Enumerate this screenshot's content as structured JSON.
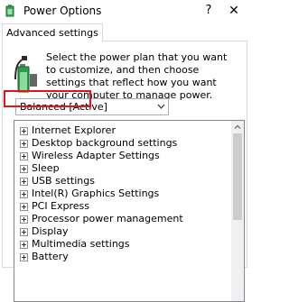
{
  "window": {
    "title": "Power Options",
    "help_label": "?",
    "close_label": "✕"
  },
  "tab": {
    "label": "Advanced settings"
  },
  "description": "Select the power plan that you want to customize, and then choose settings that reflect how you want your computer to manage power.",
  "plan_select": {
    "value": "Balanced [Active]"
  },
  "settings_tree": {
    "items": [
      {
        "label": "Internet Explorer"
      },
      {
        "label": "Desktop background settings"
      },
      {
        "label": "Wireless Adapter Settings"
      },
      {
        "label": "Sleep"
      },
      {
        "label": "USB settings",
        "highlighted": true
      },
      {
        "label": "Intel(R) Graphics Settings"
      },
      {
        "label": "PCI Express"
      },
      {
        "label": "Processor power management"
      },
      {
        "label": "Display"
      },
      {
        "label": "Multimedia settings"
      },
      {
        "label": "Battery"
      }
    ]
  },
  "colors": {
    "highlight": "#e0151c"
  }
}
